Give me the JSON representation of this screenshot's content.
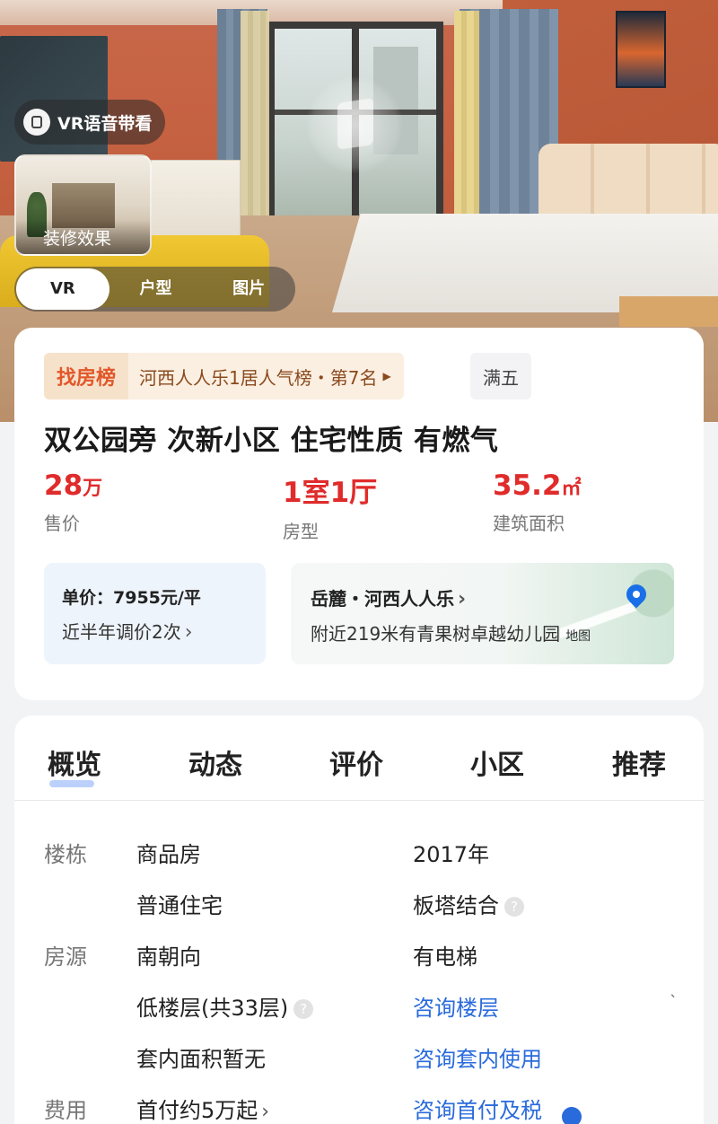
{
  "hero": {
    "vr_voice_label": "VR语音带看",
    "decoration_label": "装修效果",
    "media_tabs": [
      "VR",
      "户型",
      "图片"
    ],
    "active_media_tab": "VR"
  },
  "ranking": {
    "logo_text": "找房榜",
    "text": "河西人人乐1居人气榜・第7名",
    "tag": "满五"
  },
  "listing": {
    "title": "双公园旁 次新小区 住宅性质 有燃气",
    "price": {
      "value": "28",
      "unit": "万",
      "label": "售价"
    },
    "layout": {
      "value": "1室1厅",
      "label": "房型"
    },
    "area": {
      "value": "35.2",
      "unit": "㎡",
      "label": "建筑面积"
    }
  },
  "unit_price": {
    "line1": "单价：7955元/平",
    "line2": "近半年调价2次"
  },
  "location": {
    "line1": "岳麓・河西人人乐",
    "line2": "附近219米有青果树卓越幼儿园",
    "map_label": "地图"
  },
  "section_tabs": [
    "概览",
    "动态",
    "评价",
    "小区",
    "推荐"
  ],
  "active_section_tab": "概览",
  "overview": {
    "building_label": "楼栋",
    "source_label": "房源",
    "cost_label": "费用",
    "property_type": "商品房",
    "year": "2017年",
    "usage": "普通住宅",
    "structure": "板塔结合",
    "orientation": "南朝向",
    "elevator": "有电梯",
    "floor": "低楼层(共33层)",
    "floor_link": "咨询楼层",
    "inner_area": "套内面积暂无",
    "inner_area_link": "咨询套内使用",
    "down_payment": "首付约5万起",
    "down_payment_link": "咨询首付及税"
  },
  "colors": {
    "price_red": "#e02b2b",
    "link_blue": "#2a6bdc",
    "rank_brown": "#8a4a1d"
  }
}
